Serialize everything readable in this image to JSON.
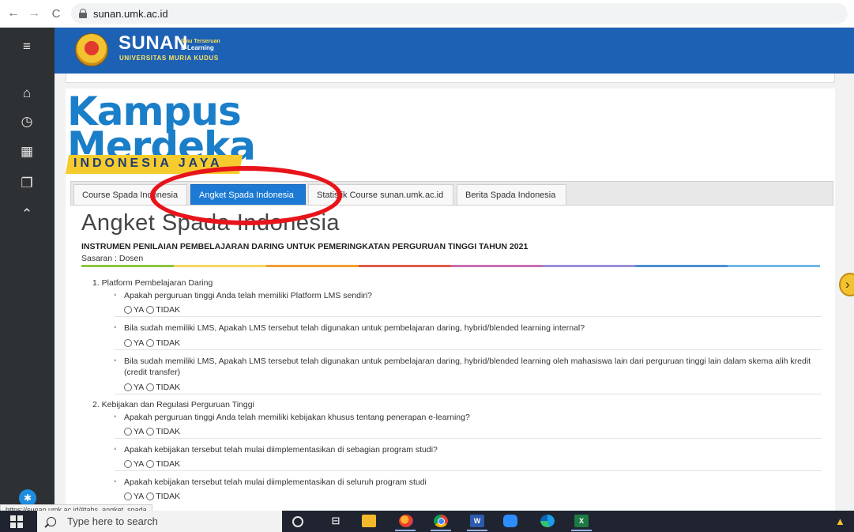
{
  "browser": {
    "back_glyph": "←",
    "forward_glyph": "→",
    "reload_glyph": "C",
    "url": "sunan.umk.ac.id"
  },
  "sidebar": {
    "menu_glyph": "≡",
    "items": [
      {
        "name": "home-icon",
        "glyph": "⌂"
      },
      {
        "name": "dashboard-icon",
        "glyph": "◷"
      },
      {
        "name": "calendar-icon",
        "glyph": "▦"
      },
      {
        "name": "files-icon",
        "glyph": "❐"
      },
      {
        "name": "graduation-cap-icon",
        "glyph": "⌃"
      }
    ],
    "accessibility_glyph": "✱"
  },
  "header": {
    "logo_title": "SUNAN",
    "logo_tag_line1": "Ilmu Terseruan",
    "logo_tag_line2": "E-Learning",
    "logo_university": "UNIVERSITAS MURIA KUDUS"
  },
  "banner": {
    "line1": "Kampus",
    "line2": "Merdeka",
    "line3": "INDONESIA JAYA"
  },
  "tabs": [
    {
      "label": "Course Spada Indonesia",
      "active": false
    },
    {
      "label": "Angket Spada Indonesia",
      "active": true
    },
    {
      "label": "Statistik Course sunan.umk.ac.id",
      "active": false
    },
    {
      "label": "Berita Spada Indonesia",
      "active": false
    }
  ],
  "survey": {
    "title": "Angket Spada Indonesia",
    "instrument": "INSTRUMEN PENILAIAN PEMBELAJARAN DARING UNTUK PEMERINGKATAN PERGURUAN TINGGI TAHUN 2021",
    "target": "Sasaran : Dosen",
    "option_yes": "YA",
    "option_no": "TIDAK",
    "sections": [
      {
        "title": "1. Platform Pembelajaran Daring",
        "questions": [
          "Apakah perguruan tinggi Anda telah memiliki Platform LMS sendiri?",
          "Bila sudah memiliki LMS, Apakah LMS tersebut telah digunakan untuk pembelajaran daring, hybrid/blended learning internal?",
          "Bila sudah memiliki LMS, Apakah LMS tersebut telah digunakan untuk pembelajaran daring, hybrid/blended learning oleh mahasiswa lain dari perguruan tinggi lain dalam skema alih kredit (credit transfer)"
        ]
      },
      {
        "title": "2. Kebijakan dan Regulasi Perguruan Tinggi",
        "questions": [
          "Apakah perguruan tinggi Anda telah memiliki kebijakan khusus tentang penerapan e-learning?",
          "Apakah kebijakan tersebut telah mulai diimplementasikan di sebagian program studi?",
          "Apakah kebijakan tersebut telah mulai diimplementasikan di seluruh program studi"
        ]
      }
    ],
    "rule_colors": [
      "#8dc63f",
      "#f6d55c",
      "#f39c32",
      "#e05a47",
      "#c86fb0",
      "#9b8fd6",
      "#4f8fd1",
      "#6fb7e8"
    ]
  },
  "side_arrow_glyph": "›",
  "status_url": "https://sunan.umk.ac.id/#tabs_angket_spada",
  "taskbar": {
    "search_placeholder": "Type here to search",
    "taskview_glyph": "⊟",
    "word_letter": "W",
    "excel_letter": "X",
    "notify_glyph": "▲"
  }
}
